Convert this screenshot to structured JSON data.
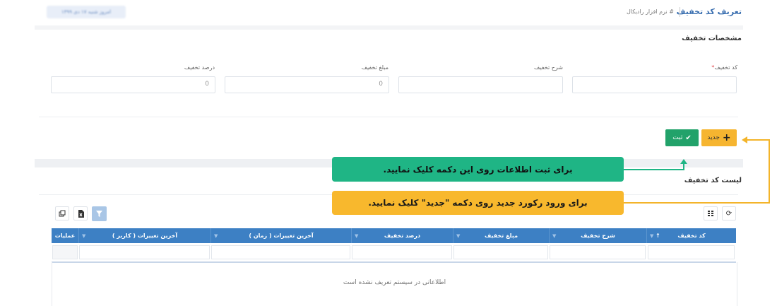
{
  "header": {
    "title": "تعریف کد تخفیف",
    "breadcrumb": "# نرم افزار رادیکال",
    "badge": "امروز شنبه ۱۷ دی ۱۳۹۹"
  },
  "form": {
    "section_title": "مشخصات تخفیف",
    "fields": [
      {
        "label": "کد تخفیف",
        "required_mark": "*",
        "value": ""
      },
      {
        "label": "شرح تخفیف",
        "value": ""
      },
      {
        "label": "مبلغ تخفیف",
        "value": "0"
      },
      {
        "label": "درصد تخفیف",
        "value": "0"
      }
    ]
  },
  "actions": {
    "new_label": "جدید",
    "save_label": "ثبت"
  },
  "callouts": {
    "save_hint": "برای ثبت اطلاعات روی این دکمه کلیک نمایید.",
    "new_hint": "برای ورود رکورد جدید روی دکمه \"جدید\" کلیک نمایید."
  },
  "list": {
    "title": "لیست کد تخفیف",
    "columns": [
      "کد تخفیف",
      "شرح تخفیف",
      "مبلغ تخفیف",
      "درصد تخفیف",
      "آخرین تغییرات ( زمان )",
      "آخرین تغییرات ( کاربر )",
      "عملیات"
    ],
    "sort_indicator": "↑",
    "empty_message": "اطلاعاتی در سیستم تعریف نشده است"
  },
  "colors": {
    "table_header": "#3d80c4",
    "save_button": "#22a26a",
    "new_button": "#f6b530",
    "callout_green": "#1fb585",
    "callout_orange": "#f8b82d"
  }
}
